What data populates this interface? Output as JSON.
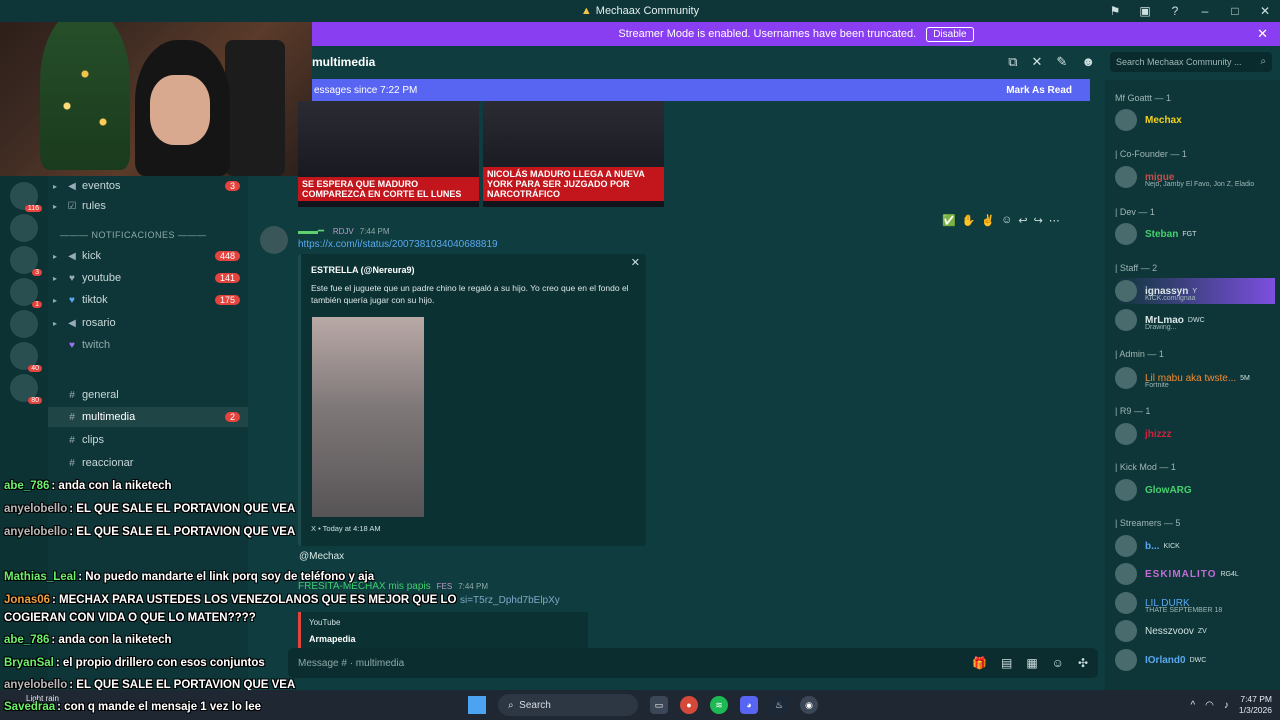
{
  "titlebar": {
    "title": "Mechaax Community",
    "icons": [
      "inbox-icon",
      "screen-icon",
      "help-icon",
      "minimize-icon",
      "maximize-icon",
      "close-icon"
    ]
  },
  "banner": {
    "text": "Streamer Mode is enabled. Usernames have been truncated.",
    "button": "Disable"
  },
  "header": {
    "channel": "multimedia",
    "search_placeholder": "Search Mechaax Community ..."
  },
  "new_bar": {
    "text": "essages since 7:22 PM",
    "mark": "Mark As Read"
  },
  "thumbs": [
    {
      "caption": "SE ESPERA QUE MADURO COMPAREZCA EN CORTE EL LUNES"
    },
    {
      "caption": "NICOLÁS MADURO LLEGA A NUEVA YORK PARA SER JUZGADO POR NARCOTRÁFICO"
    }
  ],
  "message1": {
    "tag": "RDJV",
    "time": "7:44 PM",
    "link": "https://x.com/i/status/2007381034040688819"
  },
  "embed": {
    "author": "ESTRELLA (@Nereura9)",
    "text": "Este fue el juguete que un padre chino le regaló a su hijo. Yo creo que en el fondo el también quería jugar con su hijo.",
    "footer": "X • Today at 4:18 AM"
  },
  "mention": "@Mechax",
  "message2": {
    "author": "FRESITA-MECHAX mis papis",
    "tag": "FES",
    "time": "7:44 PM",
    "link": "si=T5rz_Dphd7bElpXy"
  },
  "youtube": {
    "source": "YouTube",
    "title": "Armapedia"
  },
  "composer": {
    "placeholder": "Message #  · multimedia"
  },
  "channels": {
    "notif_header": "NOTIFICACIONES",
    "items": [
      {
        "name": "eventos",
        "count": "3"
      },
      {
        "name": "rules",
        "count": ""
      },
      {
        "name": "kick",
        "count": "448"
      },
      {
        "name": "youtube",
        "count": "141"
      },
      {
        "name": "tiktok",
        "count": "175"
      },
      {
        "name": "rosario",
        "count": ""
      },
      {
        "name": "twitch",
        "count": ""
      },
      {
        "name": "general",
        "count": ""
      },
      {
        "name": "multimedia",
        "count": "2"
      },
      {
        "name": "clips",
        "count": ""
      },
      {
        "name": "reaccionar",
        "count": ""
      }
    ]
  },
  "servers": [
    {
      "badge": "116"
    },
    {
      "badge": ""
    },
    {
      "badge": "3"
    },
    {
      "badge": "1"
    },
    {
      "badge": ""
    },
    {
      "badge": "40"
    },
    {
      "badge": "80"
    }
  ],
  "members": {
    "groups": [
      "Mf Goattt — 1",
      "| Co-Founder — 1",
      "| Dev — 1",
      "| Staff — 2",
      "| Admin — 1",
      "| R9 — 1",
      "| Kick Mod — 1",
      "| Streamers — 5"
    ],
    "users": [
      {
        "name": "Mechax",
        "color": "#f2d21b",
        "tag": "",
        "sub": ""
      },
      {
        "name": "migue",
        "color": "#c0504d",
        "tag": "",
        "sub": "Nejo, Jamby El Favo, Jon Z, Eladio"
      },
      {
        "name": "Steban",
        "color": "#45d06d",
        "tag": "FGT",
        "sub": ""
      },
      {
        "name": "ignassyn",
        "color": "#ffffff",
        "tag": "Y",
        "sub": "KICK.com/ignaa"
      },
      {
        "name": "MrLmao",
        "color": "#ffffff",
        "tag": "DWC",
        "sub": "Drawing..."
      },
      {
        "name": "Lil mabu aka twste...",
        "color": "#f28b32",
        "tag": "5M",
        "sub": "Fortnite"
      },
      {
        "name": "jhizzz",
        "color": "#d0233b",
        "tag": "",
        "sub": ""
      },
      {
        "name": "GlowARG",
        "color": "#45d06d",
        "tag": "",
        "sub": ""
      },
      {
        "name": "b...",
        "color": "#5aa8f0",
        "tag": "KICK",
        "sub": ""
      },
      {
        "name": "ESKIMALITO",
        "color": "#c46bd8",
        "tag": "RG4L",
        "sub": ""
      },
      {
        "name": "LIL DURK",
        "color": "#5aa8f0",
        "tag": "",
        "sub": "THATE SEPTEMBER 18"
      },
      {
        "name": "Nesszvoov",
        "color": "#cfe0e0",
        "tag": "ZV",
        "sub": ""
      },
      {
        "name": "IOrland0",
        "color": "#5aa8f0",
        "tag": "DWC",
        "sub": ""
      }
    ]
  },
  "chat": [
    {
      "user": "abe_786",
      "color": "#6cf06c",
      "text": ": anda con la niketech"
    },
    {
      "user": "anyelobello",
      "color": "#b9b9b9",
      "text": ": EL QUE SALE EL PORTAVION QUE VEA"
    },
    {
      "user": "anyelobello",
      "color": "#b9b9b9",
      "text": ": EL QUE SALE EL PORTAVION QUE VEA"
    },
    {
      "user": "Mathias_Leal",
      "color": "#6cf06c",
      "text": ": No puedo mandarte el link porq soy de teléfono y aja"
    },
    {
      "user": "Jonas06",
      "color": "#f0a040",
      "text": ": MECHAX PARA USTEDES LOS VENEZOLANOS QUE ES MEJOR QUE LO"
    },
    {
      "user": "",
      "color": "#ffffff",
      "text": "COGIERAN CON VIDA O QUE LO MATEN????"
    },
    {
      "user": "abe_786",
      "color": "#6cf06c",
      "text": ": anda con la niketech"
    },
    {
      "user": "BryanSal",
      "color": "#6cf06c",
      "text": ": el propio drillero con esos conjuntos"
    },
    {
      "user": "anyelobello",
      "color": "#b9b9b9",
      "text": ": EL QUE SALE EL PORTAVION QUE VEA"
    },
    {
      "user": "Savedraa",
      "color": "#6cf06c",
      "text": ": con q mande el mensaje 1 vez lo lee"
    }
  ],
  "taskbar": {
    "search": "Search",
    "weather": "Light rain",
    "time": "7:47 PM",
    "date": "1/3/2026"
  }
}
